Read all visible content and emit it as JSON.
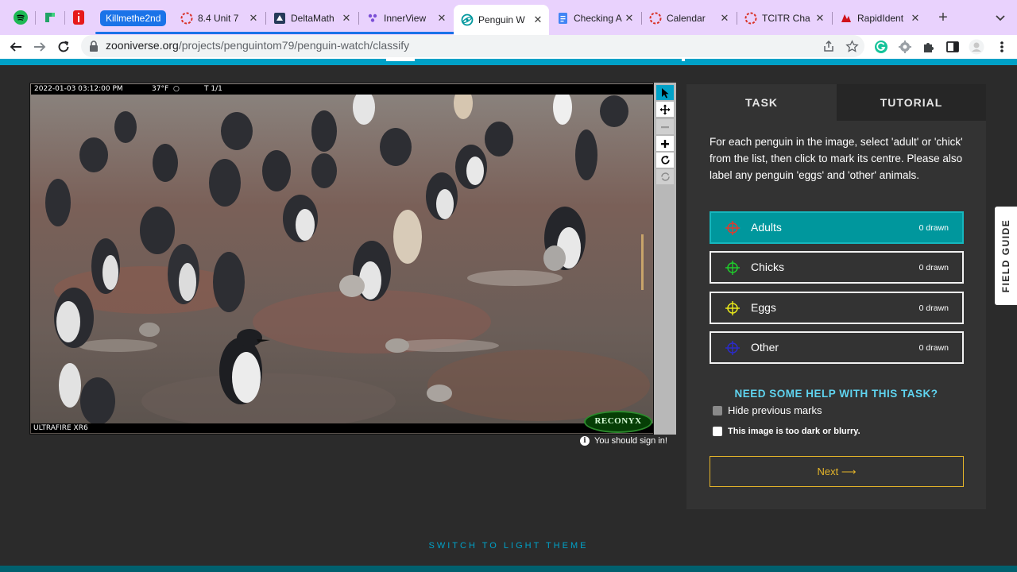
{
  "browser": {
    "pinned": [
      {
        "name": "spotify-icon",
        "color": "#1db954"
      },
      {
        "name": "app-icon",
        "color": "#21a366"
      },
      {
        "name": "app-icon",
        "color": "#e61919"
      }
    ],
    "tab_group": "Killmethe2nd",
    "tabs": [
      {
        "title": "8.4 Unit 7",
        "icon": "loading-circle-icon"
      },
      {
        "title": "DeltaMath",
        "icon": "deltamath-icon"
      },
      {
        "title": "InnerView",
        "icon": "innerview-icon"
      },
      {
        "title": "Penguin W",
        "icon": "zooniverse-icon",
        "active": true
      },
      {
        "title": "Checking A",
        "icon": "docs-icon"
      },
      {
        "title": "Calendar",
        "icon": "loading-circle-icon"
      },
      {
        "title": "TCITR Cha",
        "icon": "loading-circle-icon"
      },
      {
        "title": "RapidIdent",
        "icon": "rapididentity-icon"
      }
    ],
    "url_domain": "zooniverse.org",
    "url_path": "/projects/penguintom79/penguin-watch/classify"
  },
  "viewer": {
    "stamp_datetime": "2022-01-03 03:12:00 PM",
    "stamp_temp": "37°F",
    "stamp_counter": "T 1/1",
    "camera_model": "ULTRAFIRE XR6",
    "logo_text": "RECONYX",
    "sign_in_notice": "You should sign in!"
  },
  "task_panel": {
    "tab_task": "TASK",
    "tab_tutorial": "TUTORIAL",
    "instructions": "For each penguin in the image, select 'adult' or 'chick' from the list, then click to mark its centre. Please also label any penguin 'eggs' and 'other' animals.",
    "choices": [
      {
        "label": "Adults",
        "count": "0 drawn",
        "color": "#e03a2e",
        "active": true
      },
      {
        "label": "Chicks",
        "count": "0 drawn",
        "color": "#1fcc2b",
        "active": false
      },
      {
        "label": "Eggs",
        "count": "0 drawn",
        "color": "#e8e81a",
        "active": false
      },
      {
        "label": "Other",
        "count": "0 drawn",
        "color": "#2b2bc8",
        "active": false
      }
    ],
    "help_link": "NEED SOME HELP WITH THIS TASK?",
    "hide_marks_label": "Hide previous marks",
    "too_dark_label": "This image is too dark or blurry.",
    "next_label": "Next ⟶"
  },
  "field_guide": "FIELD GUIDE",
  "theme_switch": "SWITCH TO LIGHT THEME"
}
